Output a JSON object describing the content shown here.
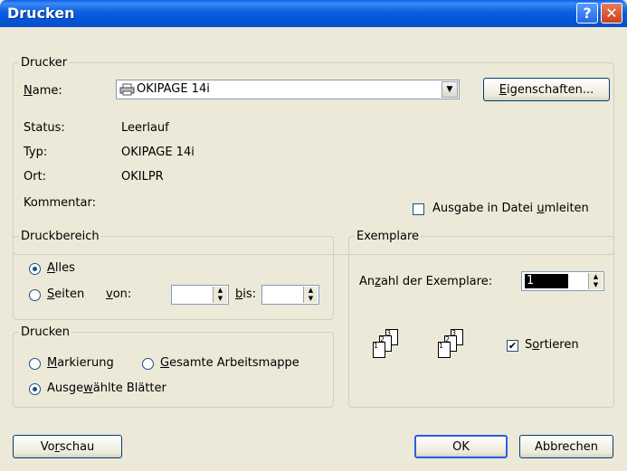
{
  "window": {
    "title": "Drucken"
  },
  "printer": {
    "legend": "Drucker",
    "name_label_u": "N",
    "name_label_rest": "ame:",
    "name_value": "OKIPAGE 14i",
    "properties_u": "E",
    "properties_rest": "igenschaften...",
    "status_label": "Status:",
    "status_value": "Leerlauf",
    "type_label": "Typ:",
    "type_value": "OKIPAGE 14i",
    "location_label": "Ort:",
    "location_value": "OKILPR",
    "comment_label": "Kommentar:",
    "print_to_file_pre": "Ausgabe in Datei ",
    "print_to_file_u": "u",
    "print_to_file_post": "mleiten",
    "print_to_file_checked": false
  },
  "range": {
    "legend": "Druckbereich",
    "all_u": "A",
    "all_rest": "lles",
    "pages_u": "S",
    "pages_rest": "eiten",
    "from_u": "v",
    "from_rest": "on:",
    "to_u": "b",
    "to_rest": "is:",
    "from_value": "",
    "to_value": "",
    "selected": "all"
  },
  "print_what": {
    "legend": "Drucken",
    "selection_u": "M",
    "selection_rest": "arkierung",
    "workbook_u": "G",
    "workbook_rest": "esamte Arbeitsmappe",
    "sheets_pre": "Ausge",
    "sheets_u": "w",
    "sheets_post": "ählte Blätter",
    "selected": "sheets"
  },
  "copies": {
    "legend": "Exemplare",
    "count_label_pre": "An",
    "count_label_u": "z",
    "count_label_post": "ahl der Exemplare:",
    "count_value": "1",
    "collate_pre": "S",
    "collate_u": "o",
    "collate_post": "rtieren",
    "collate_checked": true
  },
  "footer": {
    "preview_pre": "Vo",
    "preview_u": "r",
    "preview_post": "schau",
    "ok_label": "OK",
    "cancel_label": "Abbrechen"
  },
  "colors": {
    "titlebar": "#0455d6",
    "face": "#ece9d8"
  },
  "icons": [
    "help-icon",
    "close-icon",
    "printer-icon",
    "dropdown-arrow-icon",
    "collate-pages-icon"
  ]
}
